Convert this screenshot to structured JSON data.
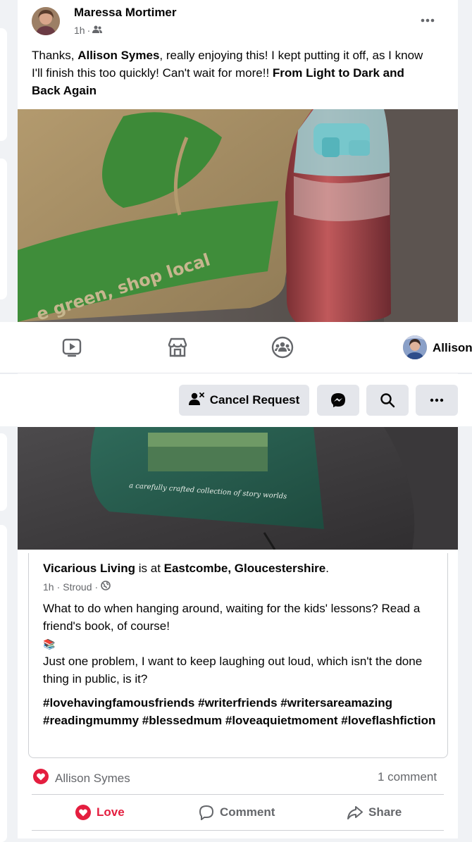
{
  "post": {
    "author": "Maressa Mortimer",
    "time": "1h",
    "dot": "·",
    "text_before": "Thanks, ",
    "mention": "Allison Symes",
    "text_mid": ", really enjoying this! I kept putting it off, as I know I'll finish this too quickly! Can't wait for more!! ",
    "book_title": "From Light to Dark and Back Again",
    "photo_text": "e green, shop local",
    "photo_caption": "a carefully crafted collection of story worlds"
  },
  "navbar": {
    "profile_name": "Allison"
  },
  "profile_actions": {
    "cancel_request": "Cancel Request"
  },
  "shared": {
    "author": "Vicarious Living",
    "is_at": " is at ",
    "place": "Eastcombe, Gloucestershire",
    "period": ".",
    "time": "1h",
    "location": "Stroud",
    "sep": "·",
    "line1": "What to do when hanging around, waiting for the kids' lessons? Read a friend's book, of course!",
    "emoji": "📚",
    "line2": "Just one problem, I want to keep laughing out loud, which isn't the done thing in public, is it?",
    "hashtags": "#lovehavingfamousfriends #writerfriends #writersareamazing #readingmummy #blessedmum #loveaquietmoment #loveflashfiction"
  },
  "reactions": {
    "name": "Allison Symes",
    "comments": "1 comment"
  },
  "actions": {
    "love": "Love",
    "comment": "Comment",
    "share": "Share"
  },
  "colors": {
    "love_red": "#e41e3f",
    "text_grey": "#65676b"
  }
}
